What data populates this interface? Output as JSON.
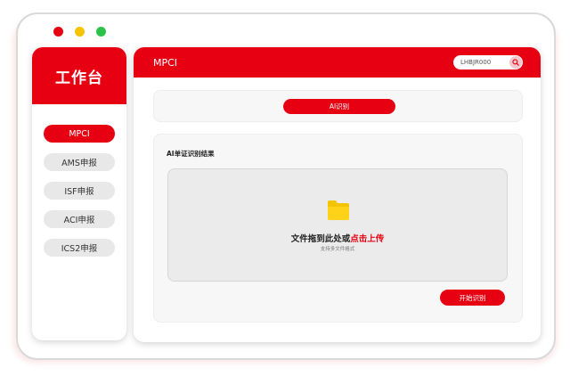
{
  "window": {
    "controls": [
      "close",
      "minimize",
      "maximize"
    ]
  },
  "sidebar": {
    "title": "工作台",
    "items": [
      {
        "label": "MPCI",
        "active": true
      },
      {
        "label": "AMS申报",
        "active": false
      },
      {
        "label": "ISF申报",
        "active": false
      },
      {
        "label": "ACI申报",
        "active": false
      },
      {
        "label": "ICS2申报",
        "active": false
      }
    ]
  },
  "header": {
    "title": "MPCI",
    "search": {
      "value": "LHBJR000",
      "icon": "search-icon"
    }
  },
  "toolbar": {
    "ai_button_label": "AI识别"
  },
  "result": {
    "title": "AI单证识别结果",
    "dropzone": {
      "icon": "folder-icon",
      "text_prefix": "文件拖到此处或",
      "text_link": "点击上传",
      "subtext": "支持多文件格式"
    },
    "start_button_label": "开始识别"
  },
  "colors": {
    "brand": "#e60012",
    "folder": "#f5c400"
  }
}
